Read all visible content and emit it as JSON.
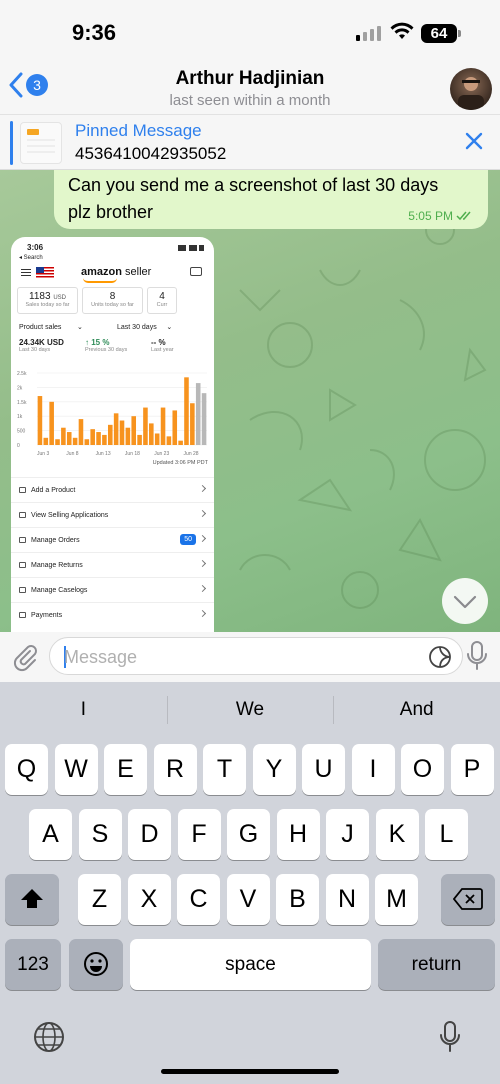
{
  "status_bar": {
    "time": "9:36",
    "battery": "64"
  },
  "header": {
    "back_badge": "3",
    "title": "Arthur Hadjinian",
    "subtitle": "last seen within a month"
  },
  "pinned": {
    "title": "Pinned Message",
    "text": "4536410042935052"
  },
  "message": {
    "text_line1": "Can you send me a screenshot of last 30 days",
    "text_line2": "plz brother",
    "time": "5:05 PM"
  },
  "screenshot": {
    "time": "3:06",
    "search": "◂ Search",
    "logo_brand": "amazon",
    "logo_suffix": "seller",
    "kpis": [
      {
        "value": "1183",
        "unit": "USD",
        "label": "Sales today so far"
      },
      {
        "value": "8",
        "unit": "",
        "label": "Units today so far"
      },
      {
        "value": "4",
        "unit": "",
        "label": "Curr"
      }
    ],
    "product_sales": "Product sales",
    "period": "Last 30 days",
    "metrics": [
      {
        "value": "24.34K USD",
        "label": "Last 30 days"
      },
      {
        "value": "↑ 15 %",
        "label": "Previous 30 days"
      },
      {
        "value": "-- %",
        "label": "Last year"
      }
    ],
    "updated": "Updated 3:06 PM PDT",
    "menu": [
      {
        "label": "Add a Product"
      },
      {
        "label": "View Selling Applications"
      },
      {
        "label": "Manage Orders",
        "badge": "50"
      },
      {
        "label": "Manage Returns"
      },
      {
        "label": "Manage Caselogs"
      },
      {
        "label": "Payments"
      }
    ]
  },
  "chart_data": {
    "type": "bar",
    "categories": [
      "Jun 3",
      "",
      "",
      "",
      "",
      "Jun 8",
      "",
      "",
      "",
      "",
      "Jun 13",
      "",
      "",
      "",
      "",
      "Jun 18",
      "",
      "",
      "",
      "",
      "Jun 23",
      "",
      "",
      "",
      "",
      "Jun 28",
      "",
      "",
      ""
    ],
    "values": [
      1700,
      250,
      1500,
      200,
      600,
      450,
      250,
      900,
      200,
      550,
      450,
      350,
      700,
      1100,
      850,
      600,
      1000,
      350,
      1300,
      750,
      400,
      1300,
      300,
      1200,
      150,
      2350,
      1450,
      2150,
      1800
    ],
    "yticks": [
      "2.5k",
      "2k",
      "1.5k",
      "1k",
      "500",
      "0"
    ],
    "xticks": [
      "Jun 3",
      "Jun 8",
      "Jun 13",
      "Jun 18",
      "Jun 23",
      "Jun 28"
    ],
    "ylim": [
      0,
      2500
    ],
    "colors": {
      "bar": "#f7931e",
      "bar_gray": "#b8b8b8",
      "bar_dark": "#f08a00"
    }
  },
  "composer": {
    "placeholder": "Message"
  },
  "keyboard": {
    "predictions": [
      "I",
      "We",
      "And"
    ],
    "row1": [
      "Q",
      "W",
      "E",
      "R",
      "T",
      "Y",
      "U",
      "I",
      "O",
      "P"
    ],
    "row2": [
      "A",
      "S",
      "D",
      "F",
      "G",
      "H",
      "J",
      "K",
      "L"
    ],
    "row3": [
      "Z",
      "X",
      "C",
      "V",
      "B",
      "N",
      "M"
    ],
    "numbers_label": "123",
    "space_label": "space",
    "return_label": "return"
  },
  "colors": {
    "accent": "#2f80ed",
    "bubble_out": "#e2f7cb",
    "check": "#4fae4e"
  }
}
